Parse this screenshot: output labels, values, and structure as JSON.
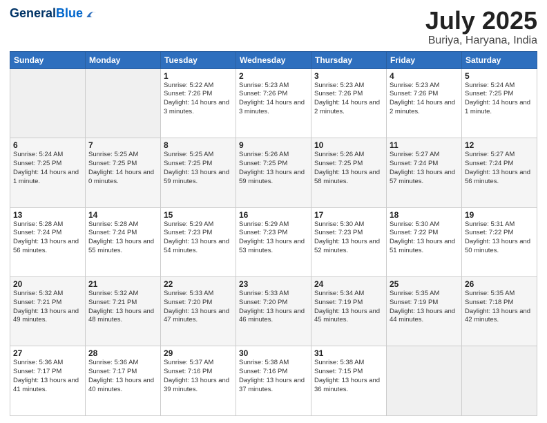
{
  "header": {
    "logo_line1": "General",
    "logo_line2": "Blue",
    "month": "July 2025",
    "location": "Buriya, Haryana, India"
  },
  "weekdays": [
    "Sunday",
    "Monday",
    "Tuesday",
    "Wednesday",
    "Thursday",
    "Friday",
    "Saturday"
  ],
  "weeks": [
    [
      {
        "day": "",
        "info": ""
      },
      {
        "day": "",
        "info": ""
      },
      {
        "day": "1",
        "info": "Sunrise: 5:22 AM\nSunset: 7:26 PM\nDaylight: 14 hours\nand 3 minutes."
      },
      {
        "day": "2",
        "info": "Sunrise: 5:23 AM\nSunset: 7:26 PM\nDaylight: 14 hours\nand 3 minutes."
      },
      {
        "day": "3",
        "info": "Sunrise: 5:23 AM\nSunset: 7:26 PM\nDaylight: 14 hours\nand 2 minutes."
      },
      {
        "day": "4",
        "info": "Sunrise: 5:23 AM\nSunset: 7:26 PM\nDaylight: 14 hours\nand 2 minutes."
      },
      {
        "day": "5",
        "info": "Sunrise: 5:24 AM\nSunset: 7:25 PM\nDaylight: 14 hours\nand 1 minute."
      }
    ],
    [
      {
        "day": "6",
        "info": "Sunrise: 5:24 AM\nSunset: 7:25 PM\nDaylight: 14 hours\nand 1 minute."
      },
      {
        "day": "7",
        "info": "Sunrise: 5:25 AM\nSunset: 7:25 PM\nDaylight: 14 hours\nand 0 minutes."
      },
      {
        "day": "8",
        "info": "Sunrise: 5:25 AM\nSunset: 7:25 PM\nDaylight: 13 hours\nand 59 minutes."
      },
      {
        "day": "9",
        "info": "Sunrise: 5:26 AM\nSunset: 7:25 PM\nDaylight: 13 hours\nand 59 minutes."
      },
      {
        "day": "10",
        "info": "Sunrise: 5:26 AM\nSunset: 7:25 PM\nDaylight: 13 hours\nand 58 minutes."
      },
      {
        "day": "11",
        "info": "Sunrise: 5:27 AM\nSunset: 7:24 PM\nDaylight: 13 hours\nand 57 minutes."
      },
      {
        "day": "12",
        "info": "Sunrise: 5:27 AM\nSunset: 7:24 PM\nDaylight: 13 hours\nand 56 minutes."
      }
    ],
    [
      {
        "day": "13",
        "info": "Sunrise: 5:28 AM\nSunset: 7:24 PM\nDaylight: 13 hours\nand 56 minutes."
      },
      {
        "day": "14",
        "info": "Sunrise: 5:28 AM\nSunset: 7:24 PM\nDaylight: 13 hours\nand 55 minutes."
      },
      {
        "day": "15",
        "info": "Sunrise: 5:29 AM\nSunset: 7:23 PM\nDaylight: 13 hours\nand 54 minutes."
      },
      {
        "day": "16",
        "info": "Sunrise: 5:29 AM\nSunset: 7:23 PM\nDaylight: 13 hours\nand 53 minutes."
      },
      {
        "day": "17",
        "info": "Sunrise: 5:30 AM\nSunset: 7:23 PM\nDaylight: 13 hours\nand 52 minutes."
      },
      {
        "day": "18",
        "info": "Sunrise: 5:30 AM\nSunset: 7:22 PM\nDaylight: 13 hours\nand 51 minutes."
      },
      {
        "day": "19",
        "info": "Sunrise: 5:31 AM\nSunset: 7:22 PM\nDaylight: 13 hours\nand 50 minutes."
      }
    ],
    [
      {
        "day": "20",
        "info": "Sunrise: 5:32 AM\nSunset: 7:21 PM\nDaylight: 13 hours\nand 49 minutes."
      },
      {
        "day": "21",
        "info": "Sunrise: 5:32 AM\nSunset: 7:21 PM\nDaylight: 13 hours\nand 48 minutes."
      },
      {
        "day": "22",
        "info": "Sunrise: 5:33 AM\nSunset: 7:20 PM\nDaylight: 13 hours\nand 47 minutes."
      },
      {
        "day": "23",
        "info": "Sunrise: 5:33 AM\nSunset: 7:20 PM\nDaylight: 13 hours\nand 46 minutes."
      },
      {
        "day": "24",
        "info": "Sunrise: 5:34 AM\nSunset: 7:19 PM\nDaylight: 13 hours\nand 45 minutes."
      },
      {
        "day": "25",
        "info": "Sunrise: 5:35 AM\nSunset: 7:19 PM\nDaylight: 13 hours\nand 44 minutes."
      },
      {
        "day": "26",
        "info": "Sunrise: 5:35 AM\nSunset: 7:18 PM\nDaylight: 13 hours\nand 42 minutes."
      }
    ],
    [
      {
        "day": "27",
        "info": "Sunrise: 5:36 AM\nSunset: 7:17 PM\nDaylight: 13 hours\nand 41 minutes."
      },
      {
        "day": "28",
        "info": "Sunrise: 5:36 AM\nSunset: 7:17 PM\nDaylight: 13 hours\nand 40 minutes."
      },
      {
        "day": "29",
        "info": "Sunrise: 5:37 AM\nSunset: 7:16 PM\nDaylight: 13 hours\nand 39 minutes."
      },
      {
        "day": "30",
        "info": "Sunrise: 5:38 AM\nSunset: 7:16 PM\nDaylight: 13 hours\nand 37 minutes."
      },
      {
        "day": "31",
        "info": "Sunrise: 5:38 AM\nSunset: 7:15 PM\nDaylight: 13 hours\nand 36 minutes."
      },
      {
        "day": "",
        "info": ""
      },
      {
        "day": "",
        "info": ""
      }
    ]
  ]
}
